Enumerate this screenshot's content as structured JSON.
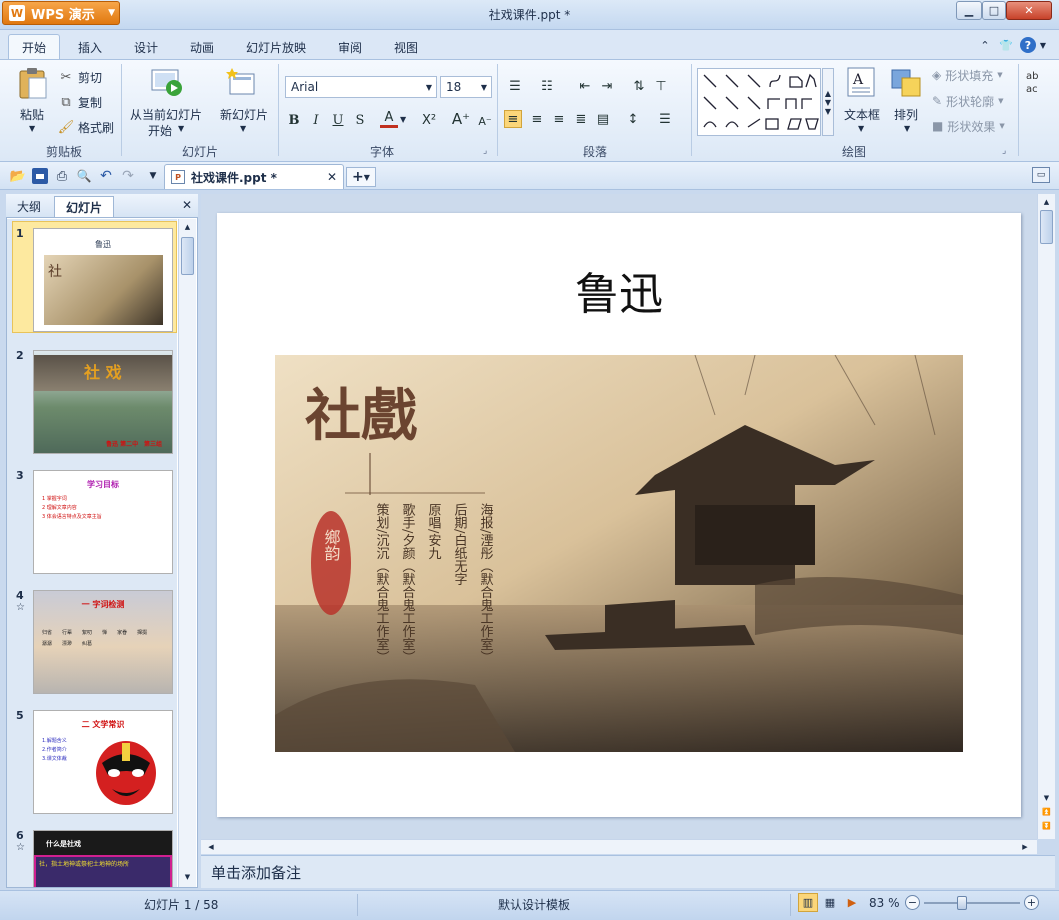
{
  "app": {
    "name": "WPS 演示",
    "window_title": "社戏课件.ppt *"
  },
  "ribbon_tabs": [
    "开始",
    "插入",
    "设计",
    "动画",
    "幻灯片放映",
    "审阅",
    "视图"
  ],
  "clipboard": {
    "paste": "粘贴",
    "cut": "剪切",
    "copy": "复制",
    "format_painter": "格式刷",
    "group": "剪贴板"
  },
  "slides_group": {
    "from_current": "从当前幻灯片",
    "from_current2": "开始",
    "new_slide": "新幻灯片",
    "group": "幻灯片"
  },
  "font": {
    "name": "Arial",
    "size": "18",
    "group": "字体",
    "bold": "B",
    "italic": "I",
    "underline": "U",
    "strike": "S"
  },
  "paragraph": {
    "group": "段落"
  },
  "drawing": {
    "textbox": "文本框",
    "arrange": "排列",
    "shape_fill": "形状填充",
    "shape_outline": "形状轮廓",
    "shape_effect": "形状效果",
    "group": "绘图"
  },
  "doc_tab": {
    "label": "社戏课件.ppt *"
  },
  "left_pane": {
    "tab_outline": "大纲",
    "tab_slides": "幻灯片"
  },
  "thumbnails": [
    {
      "num": "1",
      "title": "鲁迅"
    },
    {
      "num": "2",
      "title": "社 戏",
      "caption": "鲁迅 第二中",
      "caption2": "第三组"
    },
    {
      "num": "3",
      "title": "学习目标",
      "lines": [
        "1 掌握字词",
        "2 理解文章内容",
        "3 体会语言特点及文章主旨"
      ]
    },
    {
      "num": "4",
      "title": "一 字词检测",
      "words": [
        "归省",
        "行辈",
        "絮叨",
        "惮",
        "家眷",
        "撺掇",
        "潺潺",
        "漂渺",
        "纠葛"
      ]
    },
    {
      "num": "5",
      "title": "二 文学常识",
      "lines": [
        "1.解题含义",
        "2.作者简介",
        "3.课文体裁"
      ]
    },
    {
      "num": "6",
      "title": "什么是社戏",
      "body": "社，指土地神或祭祀土地神的场所"
    }
  ],
  "slide": {
    "title": "鲁迅",
    "image": {
      "big_title": "社戲",
      "credits": [
        "海报/湮彤（默合鬼工作室）",
        "后期/白纸无字",
        "原唱/安九",
        "歌手/夕颜（默合鬼工作室）",
        "策划/沉沉（默合鬼工作室）"
      ],
      "seal": "鄉韵"
    }
  },
  "notes": {
    "placeholder": "单击添加备注"
  },
  "status": {
    "slide_counter": "幻灯片 1 / 58",
    "template": "默认设计模板",
    "zoom": "83 %"
  }
}
